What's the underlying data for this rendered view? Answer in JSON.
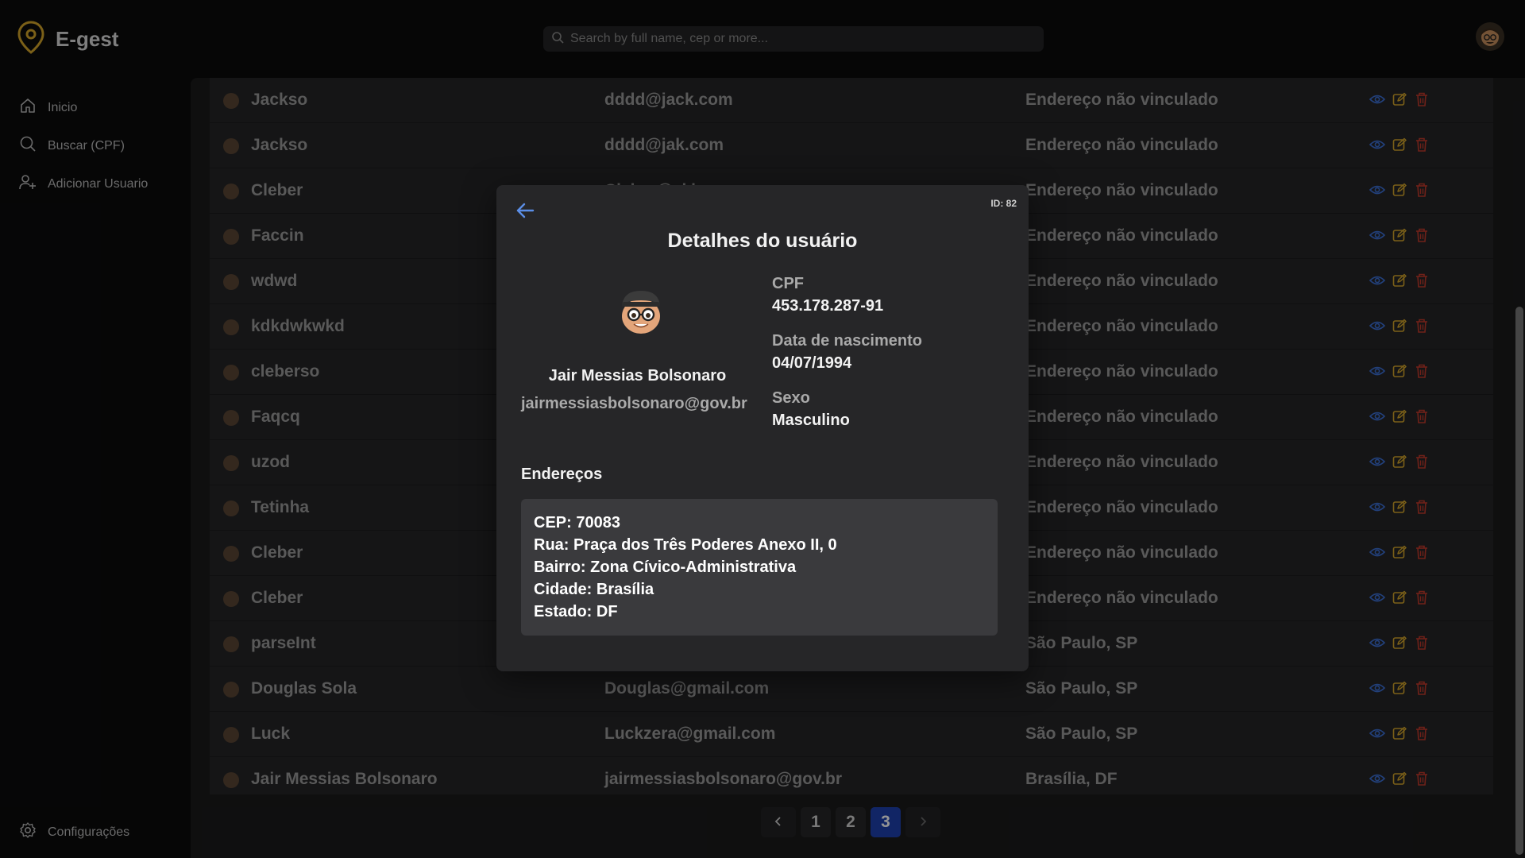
{
  "app": {
    "name": "E-gest",
    "brand_color": "#d4a52a"
  },
  "search": {
    "placeholder": "Search by full name, cep or more..."
  },
  "sidebar": {
    "items": [
      {
        "label": "Inicio",
        "icon": "home-icon"
      },
      {
        "label": "Buscar (CPF)",
        "icon": "search-icon"
      },
      {
        "label": "Adicionar Usuario",
        "icon": "add-user-icon"
      }
    ],
    "settings_label": "Configurações"
  },
  "table": {
    "rows": [
      {
        "name": "Jackso",
        "email": "dddd@jack.com",
        "address": "Endereço não vinculado"
      },
      {
        "name": "Jackso",
        "email": "dddd@jak.com",
        "address": "Endereço não vinculado"
      },
      {
        "name": "Cleber",
        "email": "Cleber@cl.bom",
        "address": "Endereço não vinculado"
      },
      {
        "name": "Faccin",
        "email": "",
        "address": "Endereço não vinculado"
      },
      {
        "name": "wdwd",
        "email": "",
        "address": "Endereço não vinculado"
      },
      {
        "name": "kdkdwkwkd",
        "email": "",
        "address": "Endereço não vinculado"
      },
      {
        "name": "cleberso",
        "email": "",
        "address": "Endereço não vinculado"
      },
      {
        "name": "Faqcq",
        "email": "",
        "address": "Endereço não vinculado"
      },
      {
        "name": "uzod",
        "email": "",
        "address": "Endereço não vinculado"
      },
      {
        "name": "Tetinha",
        "email": "",
        "address": "Endereço não vinculado"
      },
      {
        "name": "Cleber",
        "email": "",
        "address": "Endereço não vinculado"
      },
      {
        "name": "Cleber",
        "email": "",
        "address": "Endereço não vinculado"
      },
      {
        "name": "parseInt",
        "email": "",
        "address": "São Paulo, SP"
      },
      {
        "name": "Douglas Sola",
        "email": "Douglas@gmail.com",
        "address": "São Paulo, SP"
      },
      {
        "name": "Luck",
        "email": "Luckzera@gmail.com",
        "address": "São Paulo, SP"
      },
      {
        "name": "Jair Messias Bolsonaro",
        "email": "jairmessiasbolsonaro@gov.br",
        "address": "Brasília, DF"
      }
    ],
    "action_colors": {
      "view": "#3b6fd4",
      "edit": "#d4a52a",
      "delete": "#c0392b"
    }
  },
  "pagination": {
    "pages": [
      "1",
      "2",
      "3"
    ],
    "current": "3"
  },
  "modal": {
    "id_label": "ID: 82",
    "title": "Detalhes do usuário",
    "user_name": "Jair Messias Bolsonaro",
    "user_email": "jairmessiasbolsonaro@gov.br",
    "cpf_label": "CPF",
    "cpf_value": "453.178.287-91",
    "birth_label": "Data de nascimento",
    "birth_value": "04/07/1994",
    "sex_label": "Sexo",
    "sex_value": "Masculino",
    "addresses_title": "Endereços",
    "address": {
      "cep_key": "CEP:",
      "cep": "70083",
      "rua_key": "Rua:",
      "rua": "Praça dos Três Poderes Anexo II, 0",
      "bairro_key": "Bairro:",
      "bairro": "Zona Cívico-Administrativa",
      "cidade_key": "Cidade:",
      "cidade": "Brasília",
      "estado_key": "Estado:",
      "estado": "DF"
    }
  }
}
